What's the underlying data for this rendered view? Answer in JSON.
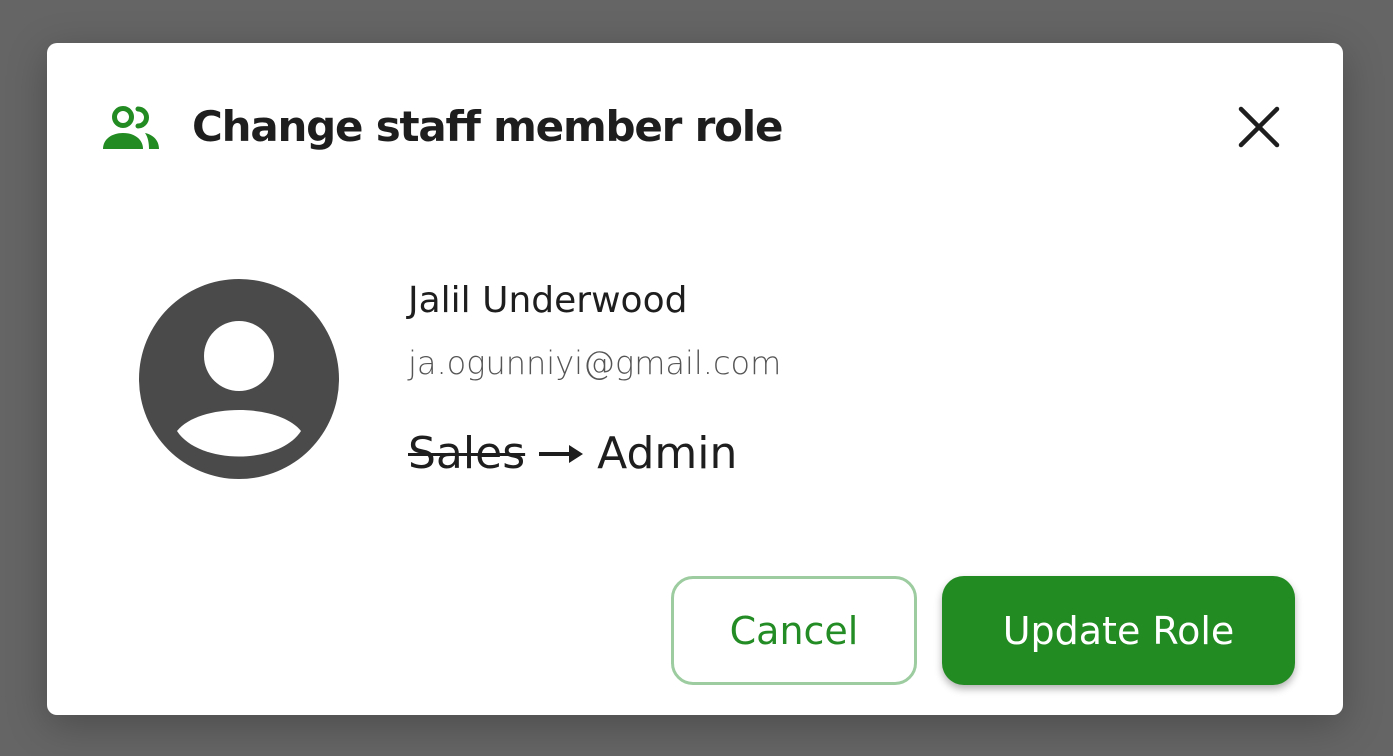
{
  "dialog": {
    "title": "Change staff member role",
    "header_icon": "people-icon",
    "close_icon": "close-icon"
  },
  "user": {
    "avatar_icon": "user-avatar-icon",
    "name": "Jalil Underwood",
    "email": "ja.ogunniyi@gmail.com",
    "old_role": "Sales",
    "new_role": "Admin",
    "arrow_icon": "arrow-right-icon"
  },
  "actions": {
    "cancel_label": "Cancel",
    "update_label": "Update Role"
  },
  "colors": {
    "accent": "#228b22",
    "cancel_border": "#9ccc9f",
    "avatar": "#4a4a4a",
    "overlay": "#656565"
  }
}
